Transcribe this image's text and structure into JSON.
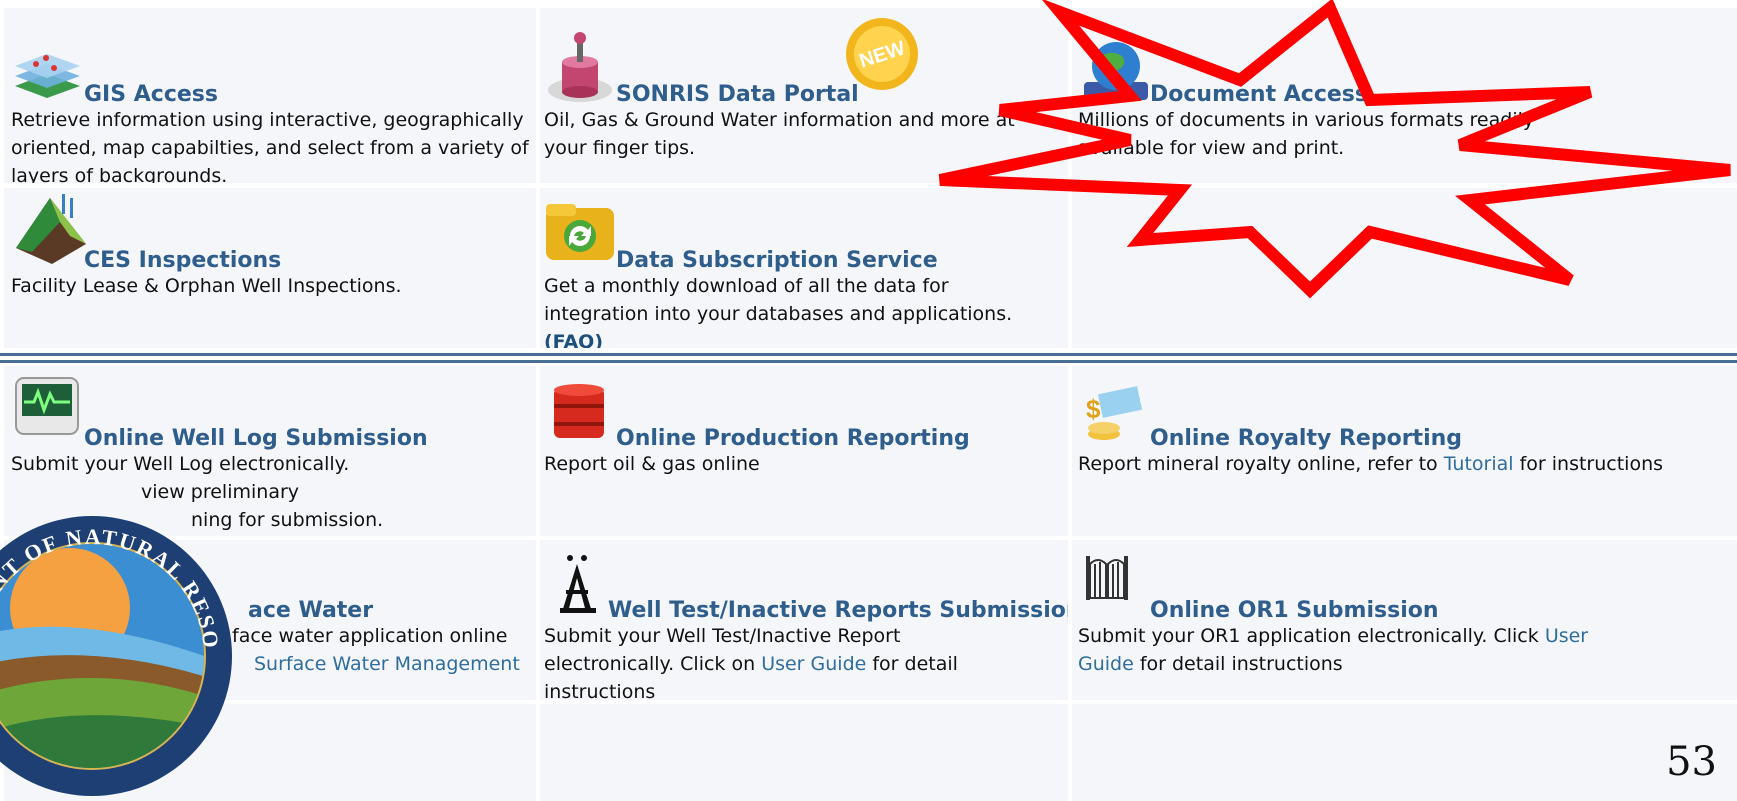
{
  "tiles": {
    "gis": {
      "title": "GIS Access",
      "desc": "Retrieve information using interactive, geographically oriented, map capabilties, and select from a variety of layers of backgrounds."
    },
    "sonris": {
      "title": "SONRIS Data Portal",
      "desc": "Oil, Gas & Ground Water information and more at your finger tips.",
      "badge": "NEW"
    },
    "document": {
      "title": "Document Access",
      "desc": "Millions of documents in various formats readily available for view and print."
    },
    "ces": {
      "title": "CES Inspections",
      "desc": "Facility Lease & Orphan Well Inspections."
    },
    "subscription": {
      "title": "Data Subscription Service",
      "desc": "Get a monthly download of all the data for integration into your databases and applications.",
      "faq": "(FAQ)"
    },
    "welllog": {
      "title": "Online Well Log Submission",
      "desc_lines": [
        "Submit your Well Log electronically.",
        "view preliminary",
        "ning for submission."
      ]
    },
    "production": {
      "title": "Online Production Reporting",
      "desc": "Report oil & gas online"
    },
    "royalty": {
      "title": "Online Royalty Reporting",
      "desc_before": "Report mineral royalty online, refer to ",
      "desc_link": "Tutorial",
      "desc_after": " for instructions"
    },
    "surface": {
      "title": "ace Water",
      "desc_line1": "face water application online",
      "desc_link": "Surface Water Management"
    },
    "welltest": {
      "title": "Well Test/Inactive Reports Submission",
      "desc_before": "Submit your Well Test/Inactive Report electronically. Click on ",
      "desc_link": "User Guide",
      "desc_after": " for detail instructions"
    },
    "or1": {
      "title": "Online OR1 Submission",
      "desc_before": "Submit your OR1 application electronically. Click ",
      "desc_link": "User Guide",
      "desc_after": " for detail instructions"
    }
  },
  "seal": {
    "text": "MENT OF NATURAL RESOURCES"
  },
  "page_number": "53",
  "colors": {
    "tile_bg": "#f4f6f9",
    "title": "#2f5e8c",
    "link": "#2f6d9c",
    "divider": "#4a6f94",
    "starburst": "#ff0000"
  }
}
